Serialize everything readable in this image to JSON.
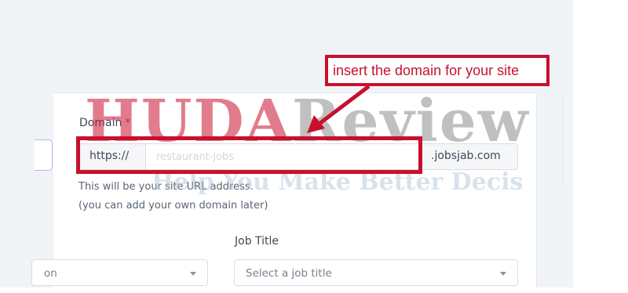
{
  "form": {
    "domain_label": "Domain",
    "required_mark": "*",
    "url_prefix": "https://",
    "subdomain_placeholder": "restaurant-jobs",
    "url_suffix": ".jobsjab.com",
    "hint_line1": "This will be your site URL address.",
    "hint_line2": "(you can add your own domain later)",
    "left_select_partial": "on",
    "job_title_label": "Job Title",
    "job_title_placeholder": "Select a job title"
  },
  "annotation": {
    "callout_text": "insert the domain for your site"
  },
  "watermark": {
    "brand_part1": "HUDA",
    "brand_part2": "Review",
    "tagline": "Help You Make Better Decis"
  },
  "colors": {
    "annotation_red": "#c8102e",
    "page_bg": "#f1f4f7"
  }
}
